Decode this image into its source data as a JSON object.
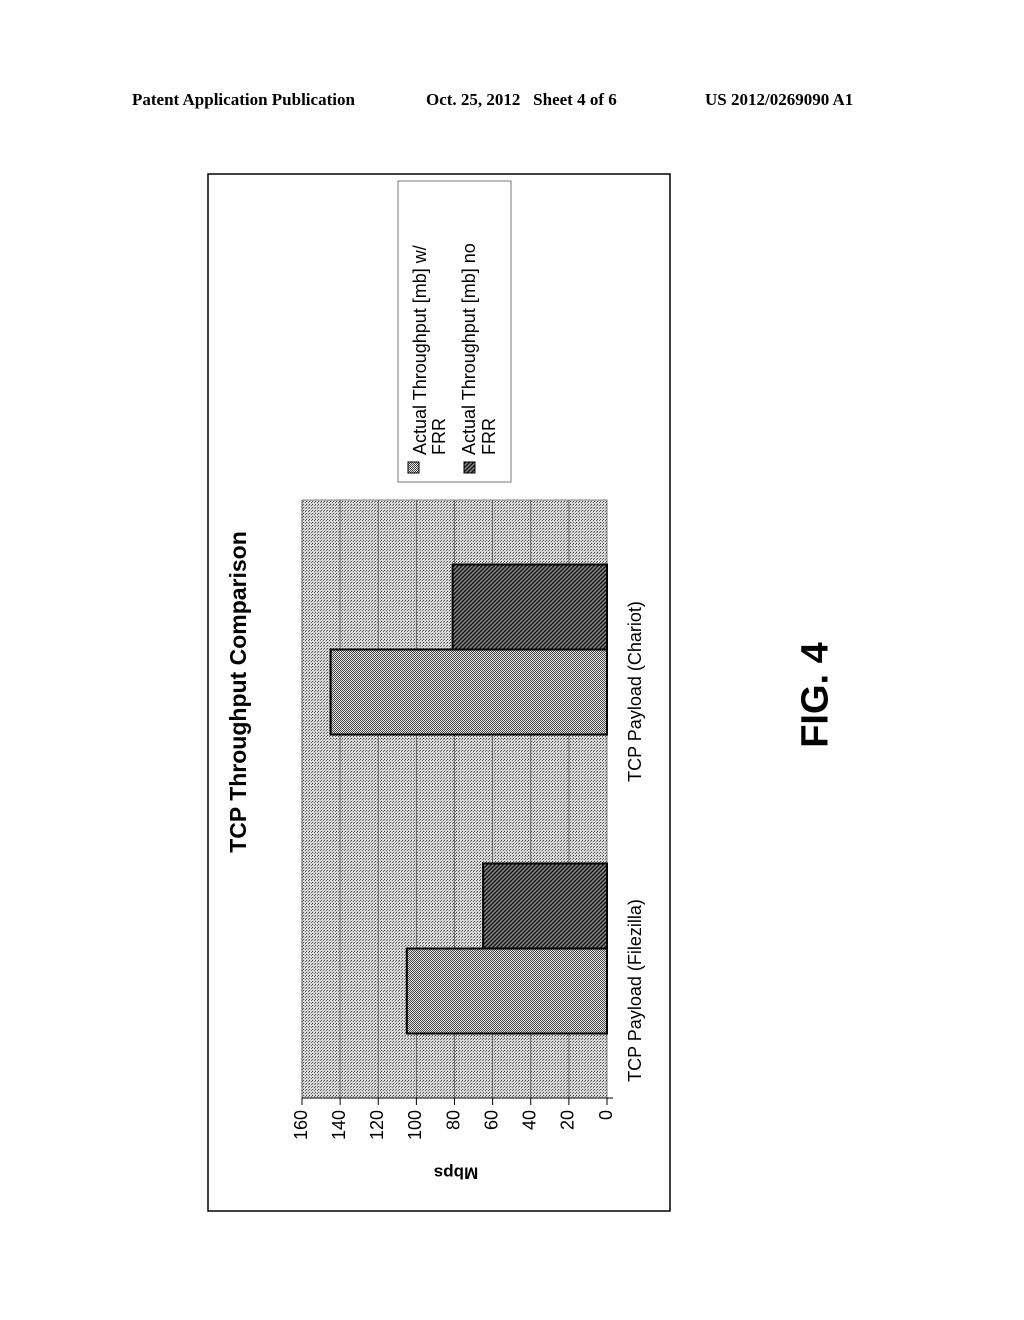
{
  "header": {
    "left": "Patent Application Publication",
    "center": "Oct. 25, 2012   Sheet 4 of 6",
    "right": "US 2012/0269090 A1"
  },
  "figure_label": "FIG. 4",
  "chart_data": {
    "type": "bar",
    "orientation": "vertical (page rotated 90° counter-clockwise)",
    "title": "TCP Throughput Comparison",
    "xlabel": "",
    "ylabel": "Mbps",
    "ylim": [
      0,
      160
    ],
    "yticks": [
      0,
      20,
      40,
      60,
      80,
      100,
      120,
      140,
      160
    ],
    "grid": true,
    "legend_position": "right",
    "categories": [
      "TCP Payload (Filezilla)",
      "TCP Payload (Chariot)"
    ],
    "series": [
      {
        "name": "Actual Throughput [mb] w/ FRR",
        "legend_lines": [
          "Actual Throughput [mb] w/",
          "FRR"
        ],
        "values": [
          105,
          145
        ],
        "pattern": "light-dots"
      },
      {
        "name": "Actual Throughput [mb] no FRR",
        "legend_lines": [
          "Actual Throughput [mb] no",
          "FRR"
        ],
        "values": [
          65,
          81
        ],
        "pattern": "dark-diagonal"
      }
    ]
  }
}
